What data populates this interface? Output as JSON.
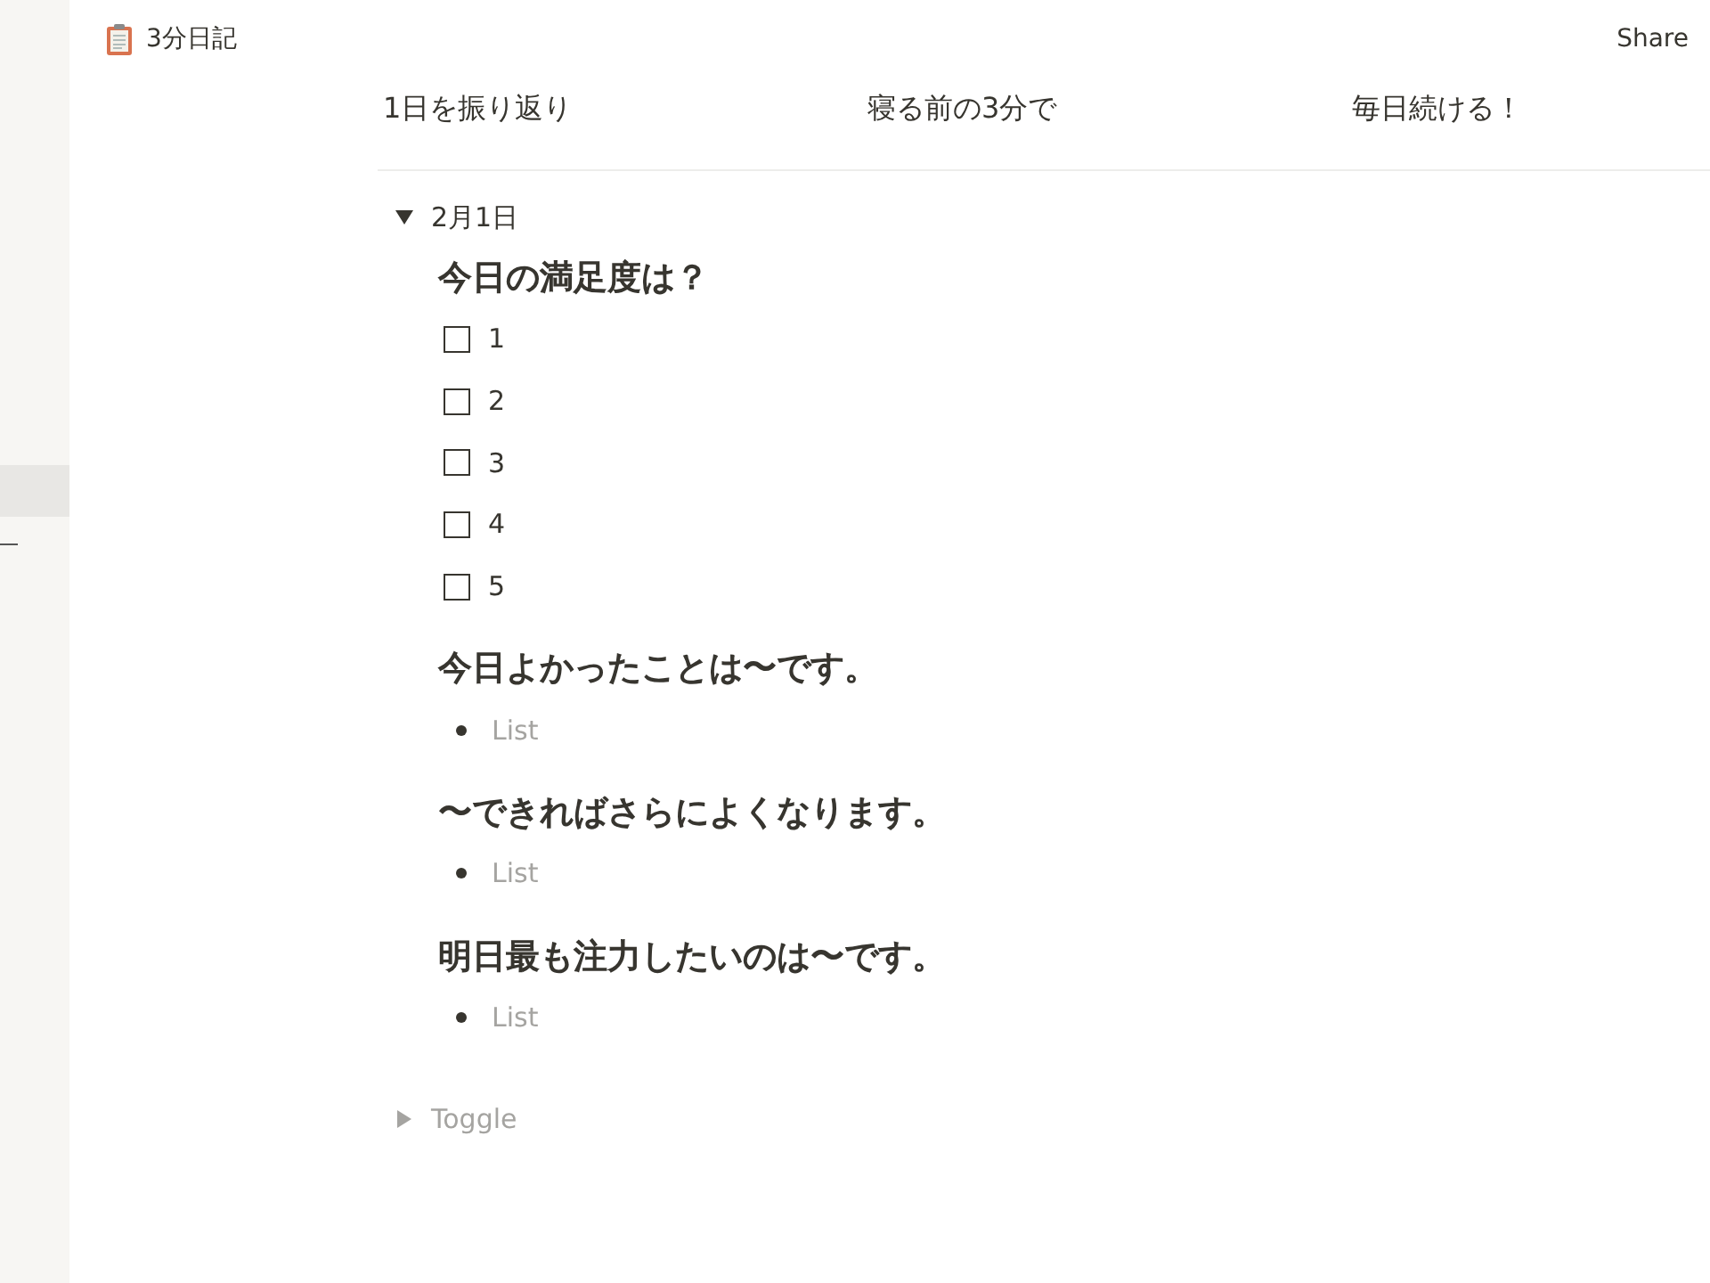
{
  "page": {
    "title": "3分日記"
  },
  "share": "Share",
  "sidebar": {
    "highlighted_row": true
  },
  "columns": [
    "1日を振り返り",
    "寝る前の3分で",
    "毎日続ける！"
  ],
  "toggles": [
    {
      "label": "2月1日",
      "expanded": true,
      "sections": [
        {
          "heading": "今日の満足度は？",
          "items": [
            {
              "kind": "checkbox",
              "text": "1",
              "checked": false
            },
            {
              "kind": "checkbox",
              "text": "2",
              "checked": false
            },
            {
              "kind": "checkbox",
              "text": "3",
              "checked": false
            },
            {
              "kind": "checkbox",
              "text": "4",
              "checked": false
            },
            {
              "kind": "checkbox",
              "text": "5",
              "checked": false
            }
          ]
        },
        {
          "heading": "今日よかったことは〜です。",
          "items": [
            {
              "kind": "bullet",
              "placeholder": "List"
            }
          ]
        },
        {
          "heading": "〜できればさらによくなります。",
          "items": [
            {
              "kind": "bullet",
              "placeholder": "List"
            }
          ]
        },
        {
          "heading": "明日最も注力したいのは〜です。",
          "items": [
            {
              "kind": "bullet",
              "placeholder": "List"
            }
          ]
        }
      ]
    },
    {
      "placeholder": "Toggle",
      "expanded": false
    }
  ]
}
